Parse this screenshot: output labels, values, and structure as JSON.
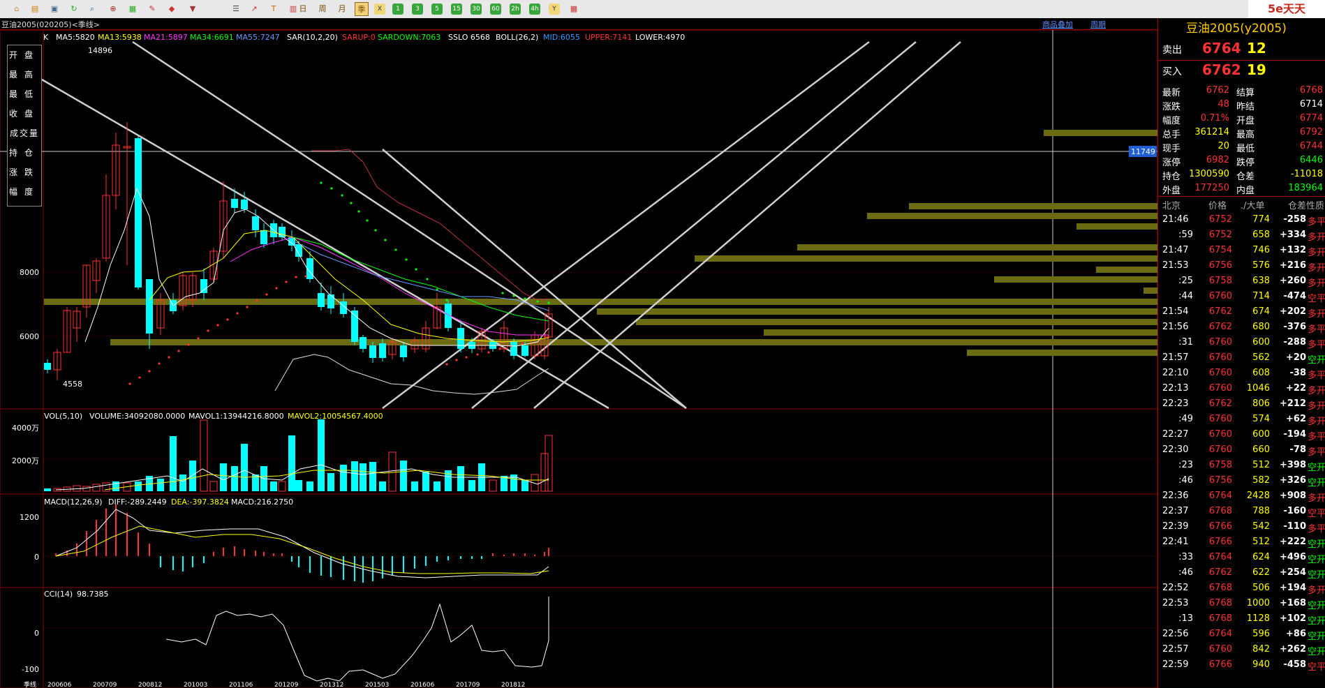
{
  "colors": {
    "up": "#ff3333",
    "down": "#00ffff",
    "yellow": "#ffff00",
    "white": "#ffffff",
    "green": "#00ff00",
    "grid": "#8b0000",
    "gold": "#6b6b12"
  },
  "toolbar": {
    "icons": [
      "home-icon",
      "folder-icon",
      "window-icon",
      "refresh-icon",
      "search-icon",
      "zoom-icon",
      "chart-icon",
      "pen-icon",
      "tag-icon",
      "filter-icon",
      "list-icon",
      "trend-icon",
      "tick-icon",
      "calendar-icon"
    ],
    "periods": [
      "日",
      "周",
      "月",
      "季"
    ],
    "minutes": [
      "X",
      "1",
      "3",
      "5",
      "15",
      "30",
      "60",
      "2h",
      "4h",
      "Y"
    ],
    "logo": "5e天天"
  },
  "title": {
    "instrument": "豆油2005(020205)<季线>",
    "link_overlay": "商品叠加",
    "link_period": "周期"
  },
  "main_indicators": {
    "k": "K",
    "ma5": "MA5:5820",
    "ma13": "MA13:5938",
    "ma21": "MA21:5897",
    "ma34": "MA34:6691",
    "ma55": "MA55:7247",
    "sar": "SAR(10,2,20)",
    "sarup": "SARUP:0",
    "sardown": "SARDOWN:7063",
    "sslo": "SSLO 6568",
    "boll": "BOLL(26,2)",
    "mid": "MID:6055",
    "upper": "UPPER:7141",
    "lower": "LOWER:4970"
  },
  "info_panel": [
    "开盘",
    "最高",
    "最低",
    "收盘",
    "成交量",
    "持仓",
    "涨跌",
    "幅度"
  ],
  "price_axis": [
    "8000",
    "6000"
  ],
  "price_high_label": "14896",
  "price_low_label": "4558",
  "crosshair_value": "11749",
  "vol": {
    "title": "VOL(5,10)",
    "volume": "VOLUME:34092080.0000",
    "mavol1": "MAVOL1:13944216.8000",
    "mavol2": "MAVOL2:10054567.4000",
    "axis": [
      "4000万",
      "2000万"
    ]
  },
  "macd": {
    "title": "MACD(12,26,9)",
    "diff": "DIFF:-289.2449",
    "dea": "DEA:-397.3824",
    "macd": "MACD:216.2750",
    "axis": [
      "1200",
      "0"
    ]
  },
  "cci": {
    "title": "CCI(14)",
    "value": "98.7385",
    "axis": [
      "0",
      "-100"
    ]
  },
  "x_dates": [
    "200606",
    "200709",
    "200812",
    "201003",
    "201106",
    "201209",
    "201312",
    "201503",
    "201606",
    "201709",
    "201812"
  ],
  "period_label": "季线",
  "quote": {
    "name": "豆油2005(y2005)",
    "sell_label": "卖出",
    "sell_price": "6764",
    "sell_vol": "12",
    "buy_label": "买入",
    "buy_price": "6762",
    "buy_vol": "19",
    "stats": [
      {
        "k1": "最新",
        "v1": "6762",
        "k2": "结算",
        "v2": "6768",
        "c1": "#ff3333",
        "c2": "#ff3333"
      },
      {
        "k1": "涨跌",
        "v1": "48",
        "k2": "昨结",
        "v2": "6714",
        "c1": "#ff3333",
        "c2": "#ffffff"
      },
      {
        "k1": "幅度",
        "v1": "0.71%",
        "k2": "开盘",
        "v2": "6774",
        "c1": "#ff3333",
        "c2": "#ff3333"
      },
      {
        "k1": "总手",
        "v1": "361214",
        "k2": "最高",
        "v2": "6792",
        "c1": "#ffff00",
        "c2": "#ff3333"
      },
      {
        "k1": "现手",
        "v1": "20",
        "k2": "最低",
        "v2": "6744",
        "c1": "#ffff00",
        "c2": "#ff3333"
      },
      {
        "k1": "涨停",
        "v1": "6982",
        "k2": "跌停",
        "v2": "6446",
        "c1": "#ff3333",
        "c2": "#00ff00"
      },
      {
        "k1": "持仓",
        "v1": "1300590",
        "k2": "仓差",
        "v2": "-11018",
        "c1": "#ffff00",
        "c2": "#ffff00"
      },
      {
        "k1": "外盘",
        "v1": "177250",
        "k2": "内盘",
        "v2": "183964",
        "c1": "#ff3333",
        "c2": "#00ff00"
      }
    ],
    "tick_headers": [
      "北京",
      "价格",
      "./大单",
      "仓差",
      "性质"
    ],
    "ticks": [
      [
        "21:46",
        "6752",
        "774",
        "-258",
        "多平"
      ],
      [
        ":59",
        "6752",
        "658",
        "+334",
        "多开"
      ],
      [
        "21:47",
        "6754",
        "746",
        "+132",
        "多开"
      ],
      [
        "21:53",
        "6756",
        "576",
        "+216",
        "多开"
      ],
      [
        ":25",
        "6758",
        "638",
        "+260",
        "多开"
      ],
      [
        ":44",
        "6760",
        "714",
        "-474",
        "空平"
      ],
      [
        "21:54",
        "6762",
        "674",
        "+202",
        "多开"
      ],
      [
        "21:56",
        "6762",
        "680",
        "-376",
        "多平"
      ],
      [
        ":31",
        "6760",
        "600",
        "-288",
        "多平"
      ],
      [
        "21:57",
        "6760",
        "562",
        "+20",
        "空开"
      ],
      [
        "22:10",
        "6760",
        "608",
        "-38",
        "多平"
      ],
      [
        "22:13",
        "6760",
        "1046",
        "+22",
        "多开"
      ],
      [
        "22:23",
        "6762",
        "806",
        "+212",
        "多开"
      ],
      [
        ":49",
        "6760",
        "574",
        "+62",
        "多开"
      ],
      [
        "22:27",
        "6760",
        "600",
        "-194",
        "多平"
      ],
      [
        "22:30",
        "6760",
        "660",
        "-78",
        "多平"
      ],
      [
        ":23",
        "6758",
        "512",
        "+398",
        "空开"
      ],
      [
        ":46",
        "6756",
        "582",
        "+326",
        "空开"
      ],
      [
        "22:36",
        "6764",
        "2428",
        "+908",
        "多开"
      ],
      [
        "22:37",
        "6768",
        "788",
        "-160",
        "空平"
      ],
      [
        "22:39",
        "6766",
        "542",
        "-110",
        "多平"
      ],
      [
        "22:41",
        "6766",
        "512",
        "+222",
        "空开"
      ],
      [
        ":33",
        "6764",
        "624",
        "+496",
        "空开"
      ],
      [
        ":46",
        "6762",
        "622",
        "+254",
        "空开"
      ],
      [
        "22:52",
        "6768",
        "506",
        "+194",
        "多开"
      ],
      [
        "22:53",
        "6768",
        "1000",
        "+168",
        "空开"
      ],
      [
        ":13",
        "6768",
        "1128",
        "+102",
        "空开"
      ],
      [
        "22:56",
        "6764",
        "596",
        "+86",
        "空开"
      ],
      [
        "22:57",
        "6760",
        "842",
        "+262",
        "空开"
      ],
      [
        "22:59",
        "6766",
        "940",
        "-458",
        "空平"
      ]
    ]
  }
}
